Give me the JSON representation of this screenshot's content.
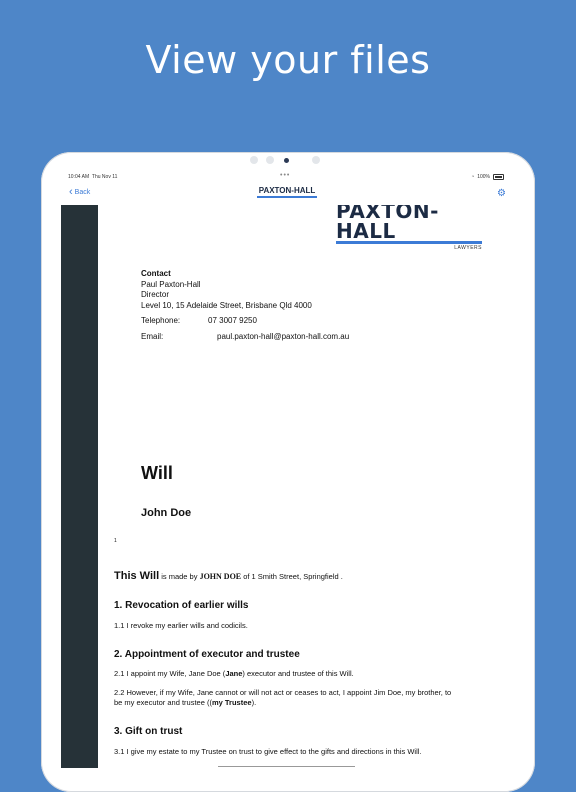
{
  "headline": "View your files",
  "status": {
    "time": "10:04 AM",
    "date": "Thu Nov 11",
    "dots": "•••",
    "battery": "100%"
  },
  "nav": {
    "back_label": "Back",
    "logo_text": "PAXTON-HALL",
    "settings_icon": "gear-icon"
  },
  "doc": {
    "logo_name": "PAXTON-HALL",
    "logo_sub": "LAWYERS",
    "contact": {
      "heading": "Contact",
      "name": "Paul Paxton-Hall",
      "role": "Director",
      "address": "Level 10, 15 Adelaide Street, Brisbane  Qld  4000",
      "tel_label": "Telephone:",
      "tel_value": "07 3007 9250",
      "email_label": "Email:",
      "email_value": "paul.paxton-hall@paxton-hall.com.au"
    },
    "title": "Will",
    "person": "John Doe",
    "page_number": "1",
    "intro": {
      "a": "This Will",
      "b": " is made by ",
      "c": "JOHN DOE",
      "d": " of 1 Smith Street, Springfield ."
    },
    "sections": [
      {
        "heading": "1. Revocation of earlier wills"
      },
      {
        "heading": "2. Appointment of executor and trustee"
      },
      {
        "heading": "3. Gift on trust"
      }
    ],
    "p11": "1.1 I revoke my earlier wills and codicils.",
    "p21": {
      "a": "2.1 I appoint my Wife, Jane Doe (",
      "b": "Jane",
      "c": ") executor and trustee of this Will."
    },
    "p22": {
      "a": "2.2 However, if my Wife, Jane cannot or will not act or ceases to act, I appoint Jim Doe, my brother, to be my executor and trustee ((",
      "b": "my Trustee",
      "c": ")."
    },
    "p31": "3.1 I give my estate to my Trustee on trust to give effect to the gifts and directions in this Will."
  }
}
